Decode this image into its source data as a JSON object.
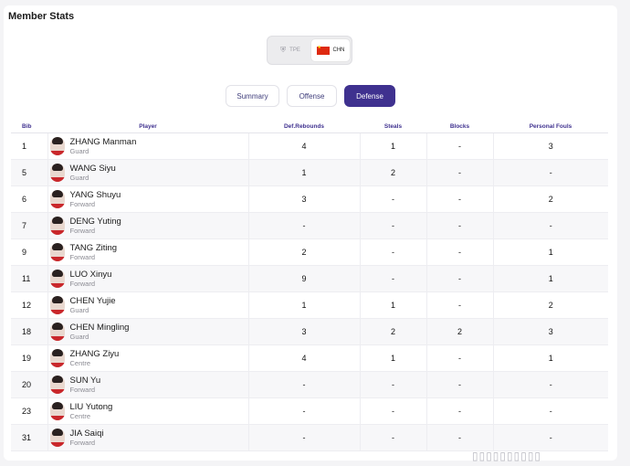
{
  "page_title": "Member Stats",
  "team_selector": {
    "teams": [
      {
        "code": "TPE",
        "icon": "emblem-icon",
        "selected": false
      },
      {
        "code": "CHN",
        "icon": "china-flag-icon",
        "selected": true
      }
    ]
  },
  "tabs": [
    {
      "label": "Summary",
      "active": false
    },
    {
      "label": "Offense",
      "active": false
    },
    {
      "label": "Defense",
      "active": true
    }
  ],
  "colors": {
    "accent": "#3f318f",
    "flag_red": "#de2910"
  },
  "table": {
    "headers": {
      "bib": "Bib",
      "player": "Player",
      "def_rebounds": "Def.Rebounds",
      "steals": "Steals",
      "blocks": "Blocks",
      "personal_fouls": "Personal Fouls"
    },
    "rows": [
      {
        "bib": "1",
        "name": "ZHANG Manman",
        "position": "Guard",
        "def_rebounds": "4",
        "steals": "1",
        "blocks": "-",
        "personal_fouls": "3"
      },
      {
        "bib": "5",
        "name": "WANG Siyu",
        "position": "Guard",
        "def_rebounds": "1",
        "steals": "2",
        "blocks": "-",
        "personal_fouls": "-"
      },
      {
        "bib": "6",
        "name": "YANG Shuyu",
        "position": "Forward",
        "def_rebounds": "3",
        "steals": "-",
        "blocks": "-",
        "personal_fouls": "2"
      },
      {
        "bib": "7",
        "name": "DENG Yuting",
        "position": "Forward",
        "def_rebounds": "-",
        "steals": "-",
        "blocks": "-",
        "personal_fouls": "-"
      },
      {
        "bib": "9",
        "name": "TANG Ziting",
        "position": "Forward",
        "def_rebounds": "2",
        "steals": "-",
        "blocks": "-",
        "personal_fouls": "1"
      },
      {
        "bib": "11",
        "name": "LUO Xinyu",
        "position": "Forward",
        "def_rebounds": "9",
        "steals": "-",
        "blocks": "-",
        "personal_fouls": "1"
      },
      {
        "bib": "12",
        "name": "CHEN Yujie",
        "position": "Guard",
        "def_rebounds": "1",
        "steals": "1",
        "blocks": "-",
        "personal_fouls": "2"
      },
      {
        "bib": "18",
        "name": "CHEN Mingling",
        "position": "Guard",
        "def_rebounds": "3",
        "steals": "2",
        "blocks": "2",
        "personal_fouls": "3"
      },
      {
        "bib": "19",
        "name": "ZHANG Ziyu",
        "position": "Centre",
        "def_rebounds": "4",
        "steals": "1",
        "blocks": "-",
        "personal_fouls": "1"
      },
      {
        "bib": "20",
        "name": "SUN Yu",
        "position": "Forward",
        "def_rebounds": "-",
        "steals": "-",
        "blocks": "-",
        "personal_fouls": "-"
      },
      {
        "bib": "23",
        "name": "LIU Yutong",
        "position": "Centre",
        "def_rebounds": "-",
        "steals": "-",
        "blocks": "-",
        "personal_fouls": "-"
      },
      {
        "bib": "31",
        "name": "JIA Saiqi",
        "position": "Forward",
        "def_rebounds": "-",
        "steals": "-",
        "blocks": "-",
        "personal_fouls": "-"
      }
    ]
  }
}
